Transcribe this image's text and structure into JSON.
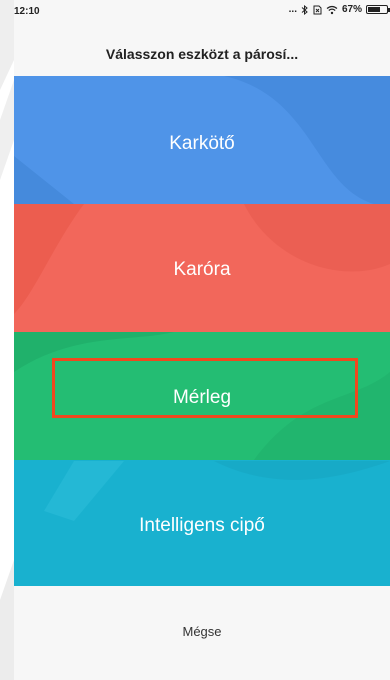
{
  "status_bar": {
    "time": "12:10",
    "dots": "...",
    "battery_percent": "67%",
    "battery_level": 0.67
  },
  "dialog": {
    "title": "Válasszon eszközt a párosí...",
    "options": [
      {
        "label": "Karkötő",
        "color": "#4f94e8"
      },
      {
        "label": "Karóra",
        "color": "#f2675b"
      },
      {
        "label": "Mérleg",
        "color": "#24bd73",
        "highlighted": true
      },
      {
        "label": "Intelligens cipő",
        "color": "#19b1cf"
      }
    ],
    "cancel_label": "Mégse"
  },
  "accent_colors": {
    "highlight_border": "#f0481e",
    "background": "#f7f7f7"
  }
}
